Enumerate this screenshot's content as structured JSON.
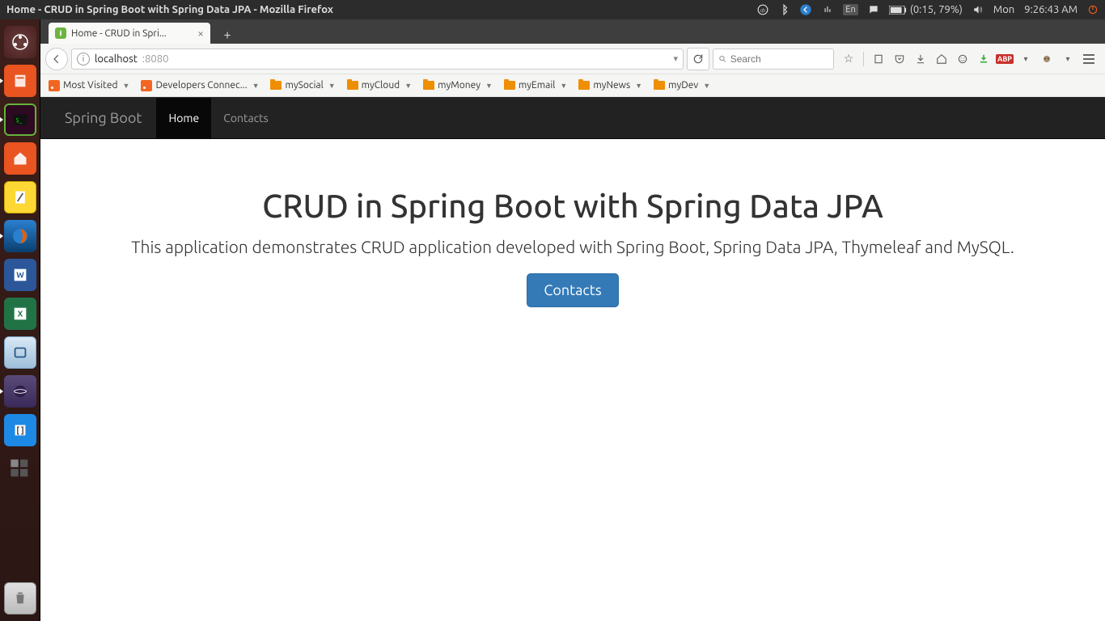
{
  "system": {
    "window_title": "Home - CRUD in Spring Boot with Spring Data JPA - Mozilla Firefox",
    "battery": "(0:15, 79%)",
    "day": "Mon",
    "time": "9:26:43 AM",
    "lang": "En"
  },
  "tab": {
    "title": "Home - CRUD in Spri..."
  },
  "url": {
    "host": "localhost",
    "port": ":8080"
  },
  "search": {
    "placeholder": "Search"
  },
  "bookmarks": [
    {
      "label": "Most Visited",
      "kind": "rss"
    },
    {
      "label": "Developers Connec...",
      "kind": "rss"
    },
    {
      "label": "mySocial",
      "kind": "folder"
    },
    {
      "label": "myCloud",
      "kind": "folder"
    },
    {
      "label": "myMoney",
      "kind": "folder"
    },
    {
      "label": "myEmail",
      "kind": "folder"
    },
    {
      "label": "myNews",
      "kind": "folder"
    },
    {
      "label": "myDev",
      "kind": "folder"
    }
  ],
  "webpage": {
    "brand": "Spring Boot",
    "nav": {
      "home": "Home",
      "contacts": "Contacts"
    },
    "heading": "CRUD in Spring Boot with Spring Data JPA",
    "lead": "This application demonstrates CRUD application developed with Spring Boot, Spring Data JPA, Thymeleaf and MySQL.",
    "button": "Contacts"
  },
  "toolbar": {
    "abp": "ABP"
  }
}
